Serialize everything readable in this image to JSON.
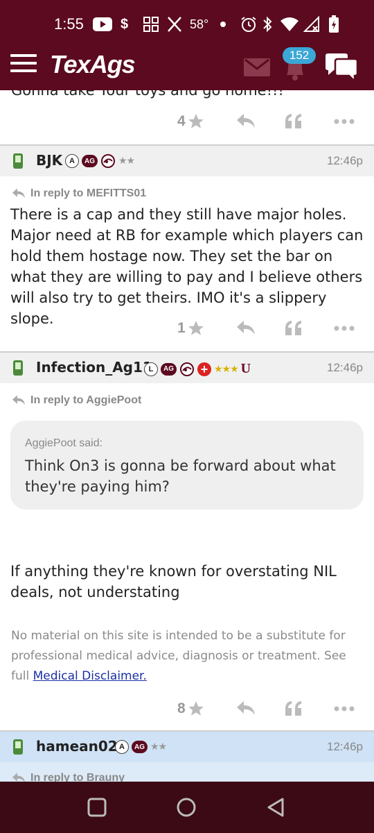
{
  "status_bar": {
    "time": "1:55",
    "temperature": "58°",
    "icons": [
      "youtube-icon",
      "dollar-icon",
      "apps-icon",
      "x-icon",
      "dot-icon",
      "alarm-icon",
      "bluetooth-icon",
      "wifi-icon",
      "signal-icon",
      "battery-icon"
    ]
  },
  "app_bar": {
    "logo": "TexAgs",
    "notification_count": "152",
    "colors": {
      "brand": "#5b0a1f",
      "badge": "#3ba7d6"
    }
  },
  "feed": {
    "partial_text": "Gonna take Your toys and go home!!!",
    "first_actions": {
      "likes": "4"
    },
    "posts": [
      {
        "username": "BJK",
        "time": "12:46p",
        "badges": [
          "A",
          "AG"
        ],
        "reply_to": "In reply to MEFITTS01",
        "body": "There is a cap and they still have major holes. Major need at RB for example which players can hold them hostage now. They set the bar on what they are willing to pay and I believe others will also try to get theirs. IMO it's a slippery slope.",
        "likes": "1"
      },
      {
        "username": "Infection_Ag11",
        "time": "12:46p",
        "badges": [
          "L",
          "AG",
          "U"
        ],
        "reply_to": "In reply to AggiePoot",
        "quote_author": "AggiePoot said:",
        "quote_text": "Think On3 is gonna be forward about what they're paying him?",
        "body": "If anything they're known for overstating NIL deals, not understating",
        "disclaimer": "No material on this site is intended to be a substitute for professional medical advice, diagnosis or treatment. See full",
        "disclaimer_link": "Medical Disclaimer.",
        "likes": "8"
      },
      {
        "username": "hamean02",
        "time": "12:46p",
        "badges": [
          "A",
          "AG"
        ],
        "reply_to": "In reply to Brauny"
      }
    ]
  }
}
